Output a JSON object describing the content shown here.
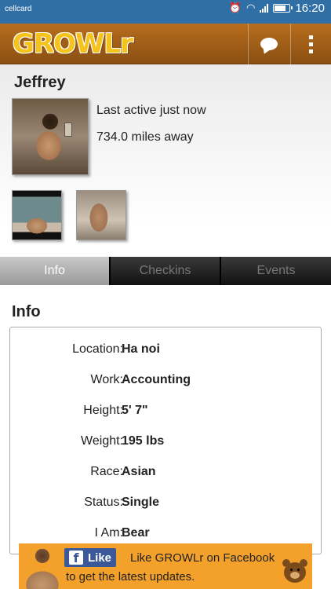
{
  "status_bar": {
    "carrier": "cellcard",
    "time": "16:20",
    "icons": [
      "alarm-icon",
      "wifi-icon",
      "signal-icon",
      "battery-icon"
    ]
  },
  "app_bar": {
    "logo": "GROWLr",
    "actions": [
      "chat-icon",
      "overflow-menu-icon"
    ]
  },
  "profile": {
    "name": "Jeffrey",
    "last_active": "Last active just now",
    "distance": "734.0 miles away"
  },
  "tabs": [
    {
      "label": "Info",
      "selected": true
    },
    {
      "label": "Checkins",
      "selected": false
    },
    {
      "label": "Events",
      "selected": false
    }
  ],
  "info": {
    "heading": "Info",
    "rows": [
      {
        "label": "Location:",
        "value": "Ha noi"
      },
      {
        "label": "Work:",
        "value": "Accounting"
      },
      {
        "label": "Height:",
        "value": "5' 7\""
      },
      {
        "label": "Weight:",
        "value": "195 lbs"
      },
      {
        "label": "Race:",
        "value": "Asian"
      },
      {
        "label": "Status:",
        "value": "Single"
      },
      {
        "label": "I Am:",
        "value": "Bear"
      }
    ]
  },
  "ad": {
    "like_button": "Like",
    "line1": "Like GROWLr on Facebook",
    "line2": "to get the latest updates."
  },
  "colors": {
    "status_bar": "#2f6fa6",
    "app_bar": "#a0601a",
    "logo": "#f6c31c",
    "ad_background": "#f3a12a",
    "facebook": "#3b5998"
  }
}
